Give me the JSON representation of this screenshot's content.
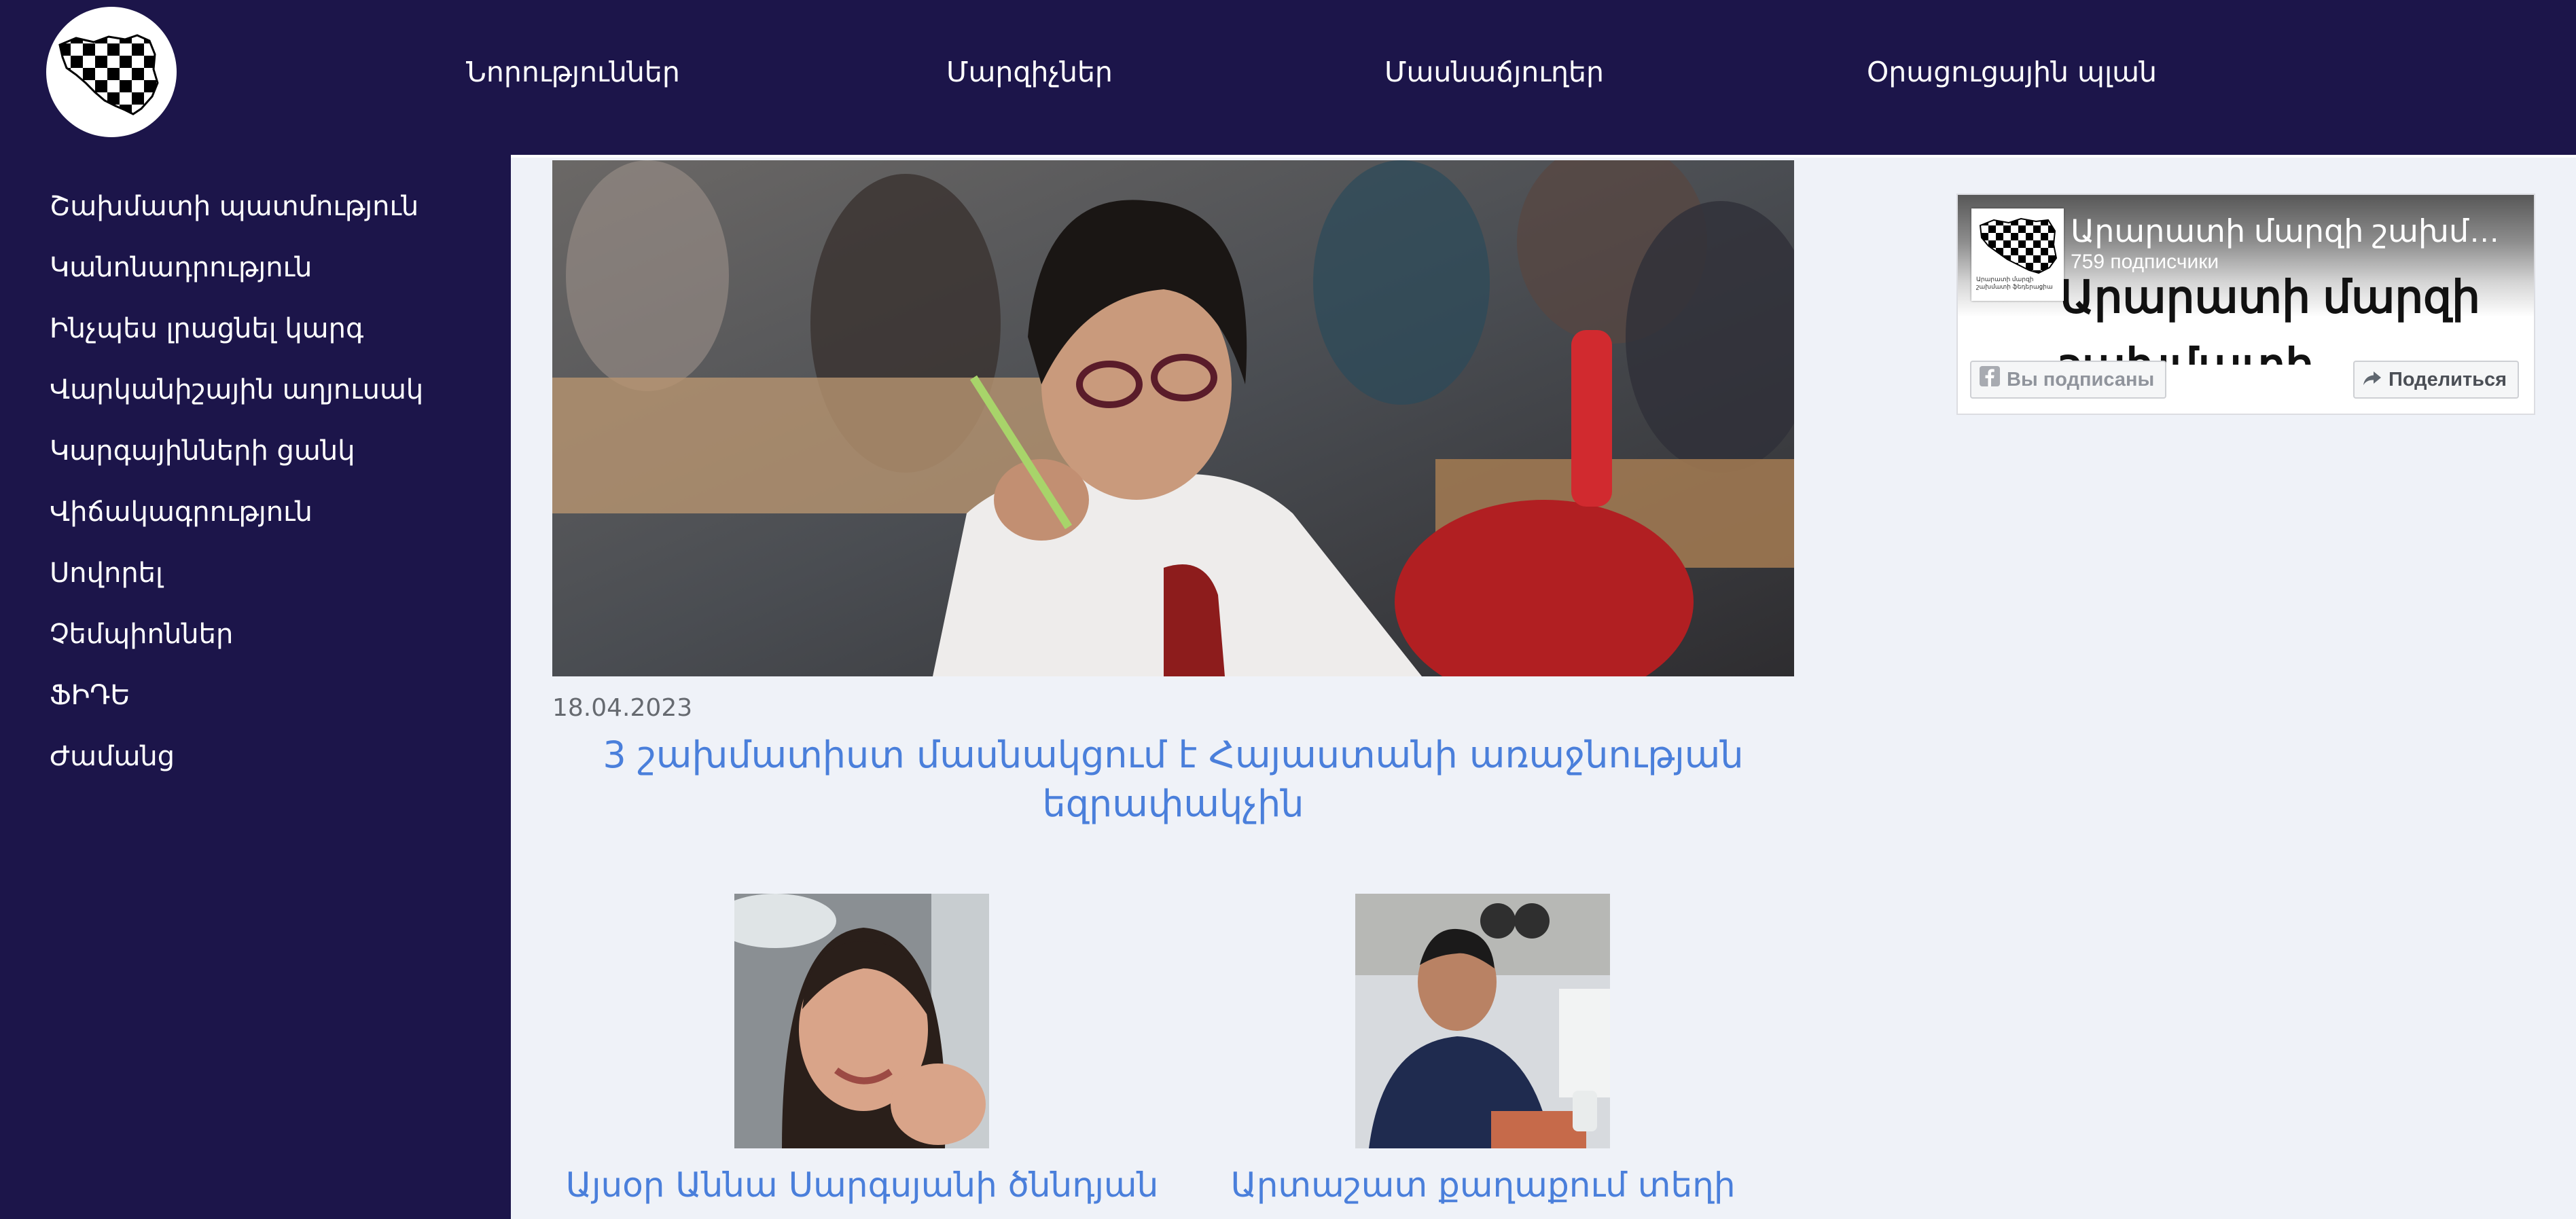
{
  "top_nav": {
    "logo_name": "chess-federation-logo",
    "items": [
      {
        "label": "Նորություններ"
      },
      {
        "label": "Մարզիչներ"
      },
      {
        "label": "Մասնաճյուղեր"
      },
      {
        "label": "Օրացուցային պլան"
      }
    ]
  },
  "sidebar": {
    "items": [
      {
        "label": "Շախմատի պատմություն"
      },
      {
        "label": "Կանոնադրություն"
      },
      {
        "label": "Ինչպես լրացնել կարգ"
      },
      {
        "label": "Վարկանիշային աղյուսակ"
      },
      {
        "label": "Կարգայինների ցանկ"
      },
      {
        "label": "Վիճակագրություն"
      },
      {
        "label": "Սովորել"
      },
      {
        "label": "Չեմպիոններ"
      },
      {
        "label": "ՖԻԴԵ"
      },
      {
        "label": "Ժամանց"
      }
    ]
  },
  "main": {
    "featured": {
      "date": "18.04.2023",
      "title": "3 շախմատիստ մասնակցում է Հայաստանի առաջնության եզրափակչին"
    },
    "cards": [
      {
        "title": "Այսօր Աննա Սարգսյանի ծննդյան"
      },
      {
        "title": "Արտաշատ քաղաքում տեղի"
      }
    ]
  },
  "facebook_widget": {
    "page_name": "Արարատի մարզի շախմատի ֆեդերացիա",
    "subscribers": "759 подписчики",
    "cover_text": "Արարատի մարզի շախմատի ֆեդերացիա",
    "subscribed_label": "Вы подписаны",
    "share_label": "Поделиться",
    "avatar_caption": "Արարատի մարզի շախմատի ֆեդերացիա"
  },
  "colors": {
    "nav_bg": "#1c154a",
    "page_bg": "#eff2f8",
    "link_blue": "#4a7fdb"
  }
}
